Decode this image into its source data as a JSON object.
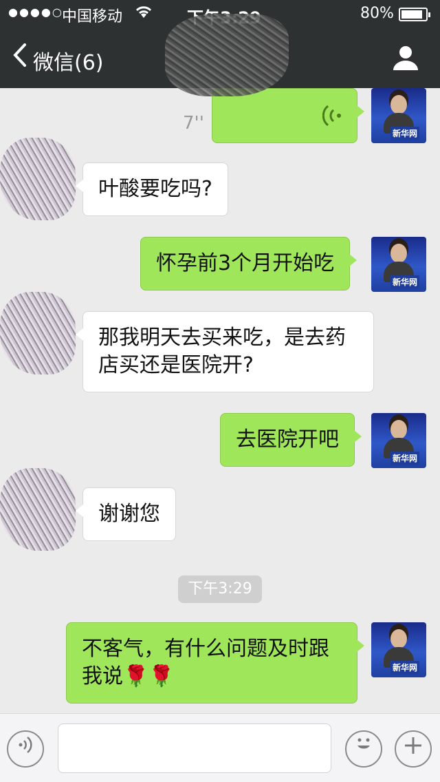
{
  "status_bar": {
    "signal": "●●●●○",
    "carrier": "中国移动",
    "wifi_icon": "wifi-icon",
    "time": "下午3:29",
    "battery": "80%",
    "battery_level": 0.8
  },
  "nav": {
    "back_icon": "chevron-left-icon",
    "title": "微信(6)",
    "profile_icon": "person-icon"
  },
  "messages": [
    {
      "side": "out",
      "type": "voice",
      "duration": "7''",
      "icon": "voice-wave-icon"
    },
    {
      "side": "in",
      "text": "叶酸要吃吗?"
    },
    {
      "side": "out",
      "text": "怀孕前3个月开始吃"
    },
    {
      "side": "in",
      "text": "那我明天去买来吃，是去药店买还是医院开?"
    },
    {
      "side": "out",
      "text": "去医院开吧"
    },
    {
      "side": "in",
      "text": "谢谢您"
    },
    {
      "side": "out",
      "text": "不客气，有什么问题及时跟我说🌹🌹"
    }
  ],
  "timestamp": "下午3:29",
  "avatar_me_logo": "新华网",
  "input_bar": {
    "voice_icon": "voice-input-icon",
    "emoji_icon": "emoji-icon",
    "plus_icon": "plus-icon"
  },
  "colors": {
    "nav_bg": "#2e3132",
    "chat_bg": "#ebebeb",
    "outgoing_bubble": "#9fe65a",
    "incoming_bubble": "#ffffff"
  }
}
